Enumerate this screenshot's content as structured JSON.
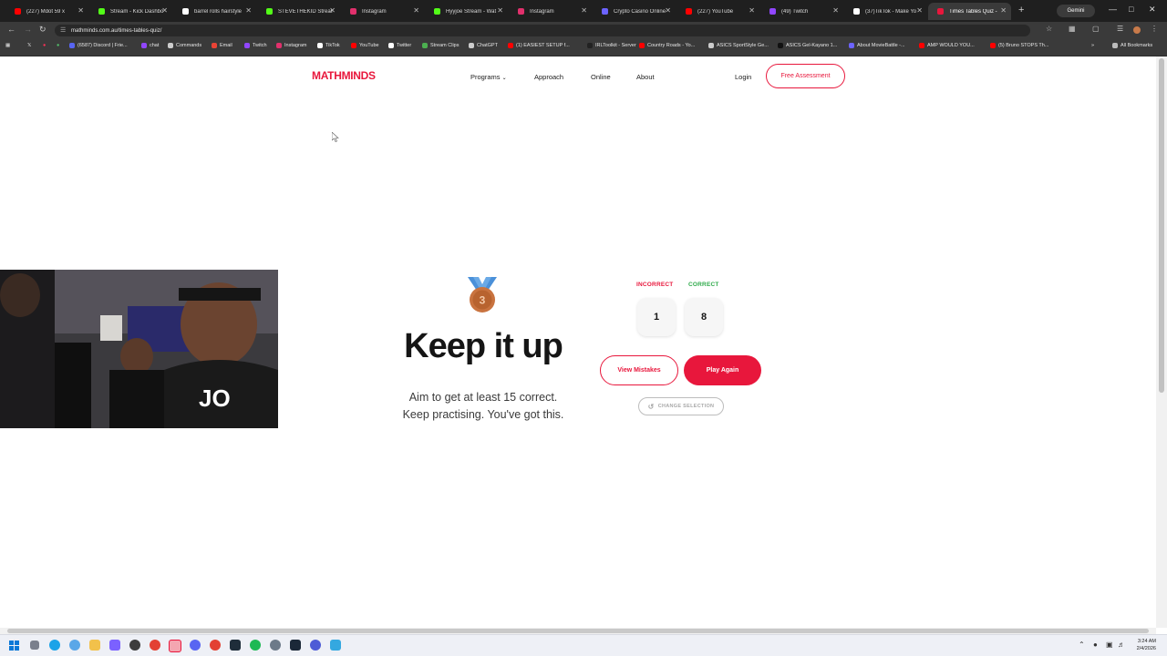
{
  "browser": {
    "tabs": [
      {
        "title": "(227) Mdot 59 x",
        "color": "#ff0000"
      },
      {
        "title": "Stream - Kick Dashbo",
        "color": "#53fc18"
      },
      {
        "title": "barrel rolls hairstyle",
        "color": "#ffffff"
      },
      {
        "title": "STEVETHEKID Stream",
        "color": "#53fc18"
      },
      {
        "title": "Instagram",
        "color": "#e1306c"
      },
      {
        "title": "Hyyjoe Stream - Wat",
        "color": "#53fc18"
      },
      {
        "title": "Instagram",
        "color": "#e1306c"
      },
      {
        "title": "Crypto Casino Online",
        "color": "#6c63ff"
      },
      {
        "title": "(227) YouTube",
        "color": "#ff0000"
      },
      {
        "title": "(49) Twitch",
        "color": "#9146ff"
      },
      {
        "title": "(37)TikTok - Make Yo",
        "color": "#ffffff"
      },
      {
        "title": "Times Tables Quiz -",
        "color": "#e8173c"
      }
    ],
    "new_tab": "+",
    "gemini": "Gemini",
    "url": "mathminds.com.au/times-tables-quiz/",
    "bookmarks": [
      {
        "label": "(6587) Discord | Frie...",
        "color": "#5865f2"
      },
      {
        "label": "chat",
        "color": "#9146ff"
      },
      {
        "label": "Commands",
        "color": "#cccccc"
      },
      {
        "label": "Email",
        "color": "#ea4335"
      },
      {
        "label": "Twitch",
        "color": "#9146ff"
      },
      {
        "label": "Instagram",
        "color": "#e1306c"
      },
      {
        "label": "TikTok",
        "color": "#ffffff"
      },
      {
        "label": "YouTube",
        "color": "#ff0000"
      },
      {
        "label": "Twitter",
        "color": "#ffffff"
      },
      {
        "label": "Stream Clips",
        "color": "#4caf50"
      },
      {
        "label": "ChatGPT",
        "color": "#cccccc"
      },
      {
        "label": "(1) EASIEST SETUP f...",
        "color": "#ff0000"
      },
      {
        "label": "IRLToolkit - Server",
        "color": "#222222"
      },
      {
        "label": "Country Roads - Yo...",
        "color": "#ff0000"
      },
      {
        "label": "ASICS SportStyle Ge...",
        "color": "#cccccc"
      },
      {
        "label": "ASICS Gel-Kayano 1...",
        "color": "#111111"
      },
      {
        "label": "About MovieBattle -...",
        "color": "#6c63ff"
      },
      {
        "label": "AMP WOULD YOU...",
        "color": "#ff0000"
      },
      {
        "label": "(5) Bruno STOPS Th...",
        "color": "#ff0000"
      }
    ],
    "all_bookmarks": "All Bookmarks"
  },
  "site": {
    "logo": "MATHMINDS",
    "nav": {
      "programs": "Programs",
      "approach": "Approach",
      "online": "Online",
      "about": "About"
    },
    "login": "Login",
    "free_assessment": "Free Assessment"
  },
  "result": {
    "medal_number": "3",
    "headline": "Keep it up",
    "message_line1": "Aim to get at least 15 correct.",
    "message_line2": "Keep practising. You've got this.",
    "incorrect_label": "INCORRECT",
    "correct_label": "CORRECT",
    "incorrect_count": "1",
    "correct_count": "8",
    "view_mistakes": "View Mistakes",
    "play_again": "Play Again",
    "change_selection": "CHANGE SELECTION"
  },
  "colors": {
    "brand": "#e8173c",
    "correct": "#2eaa4a",
    "medal": "#c9733f",
    "ribbon": "#4a90d9"
  },
  "taskbar": {
    "time": "3:24 AM",
    "date": "2/4/2026"
  }
}
